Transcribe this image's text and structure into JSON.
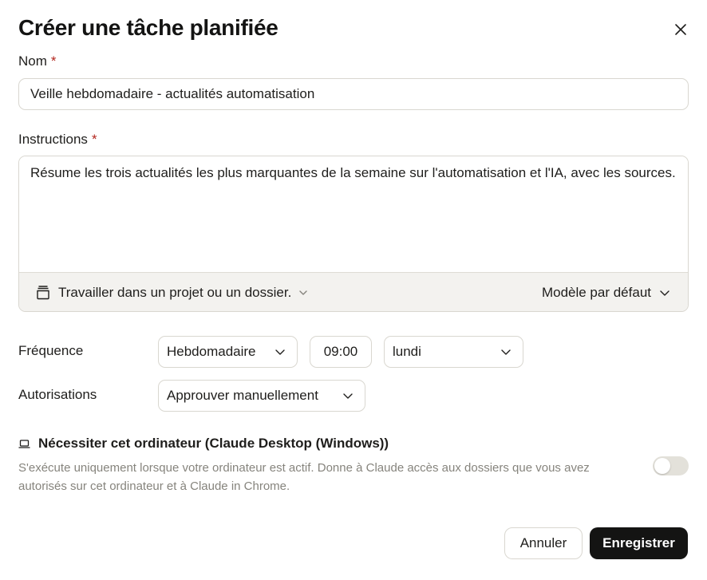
{
  "dialog": {
    "title": "Créer une tâche planifiée",
    "close_icon": "close-icon"
  },
  "form": {
    "name": {
      "label": "Nom",
      "required_mark": "*",
      "value": "Veille hebdomadaire - actualités automatisation"
    },
    "instructions": {
      "label": "Instructions",
      "required_mark": "*",
      "value": "Résume les trois actualités les plus marquantes de la semaine sur l'automatisation et l'IA, avec les sources.",
      "project_picker": {
        "icon": "folder-icon",
        "label": "Travailler dans un projet ou un dossier."
      },
      "model_picker": {
        "label": "Modèle par défaut"
      }
    },
    "frequency": {
      "label": "Fréquence",
      "period": "Hebdomadaire",
      "time": "09:00",
      "day": "lundi"
    },
    "permissions": {
      "label": "Autorisations",
      "value": "Approuver manuellement"
    },
    "require_computer": {
      "icon": "laptop-icon",
      "title": "Nécessiter cet ordinateur (Claude Desktop (Windows))",
      "description": "S'exécute uniquement lorsque votre ordinateur est actif. Donne à Claude accès aux dossiers que vous avez autorisés sur cet ordinateur et à Claude in Chrome.",
      "enabled": false
    }
  },
  "actions": {
    "cancel_label": "Annuler",
    "save_label": "Enregistrer"
  },
  "colors": {
    "required": "#b3261e",
    "primary_button": "#141413",
    "muted_text": "#86847d",
    "border": "#d9d7d0",
    "footer_bg": "#f3f2ef"
  }
}
